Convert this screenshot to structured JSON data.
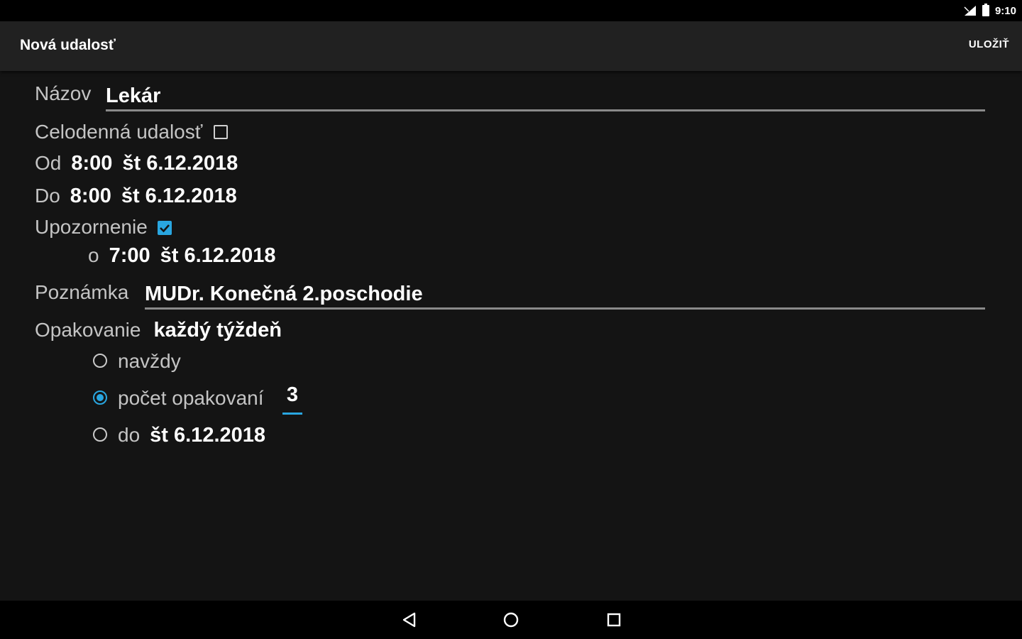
{
  "status_bar": {
    "time": "9:10",
    "icons": [
      "signal-icon",
      "battery-icon"
    ]
  },
  "app_bar": {
    "title": "Nová udalosť",
    "save_label": "ULOŽIŤ"
  },
  "form": {
    "name": {
      "label": "Názov",
      "value": "Lekár"
    },
    "all_day": {
      "label": "Celodenná udalosť",
      "checked": false
    },
    "from": {
      "label": "Od",
      "time": "8:00",
      "date": "št 6.12.2018"
    },
    "to": {
      "label": "Do",
      "time": "8:00",
      "date": "št 6.12.2018"
    },
    "reminder": {
      "label": "Upozornenie",
      "checked": true,
      "prefix": "o",
      "time": "7:00",
      "date": "št 6.12.2018"
    },
    "note": {
      "label": "Poznámka",
      "value": "MUDr. Konečná 2.poschodie"
    },
    "repeat": {
      "label": "Opakovanie",
      "value": "každý týždeň",
      "options": {
        "forever": {
          "label": "navždy",
          "selected": false
        },
        "count": {
          "label": "počet opakovaní",
          "value": "3",
          "selected": true
        },
        "until": {
          "label": "do",
          "date": "št 6.12.2018",
          "selected": false
        }
      }
    }
  },
  "nav_bar": {
    "icons": [
      "back-icon",
      "home-icon",
      "recents-icon"
    ]
  },
  "colors": {
    "background": "#141414",
    "app_bar": "#212121",
    "accent": "#29a6e0",
    "label": "#c4c4c4"
  }
}
